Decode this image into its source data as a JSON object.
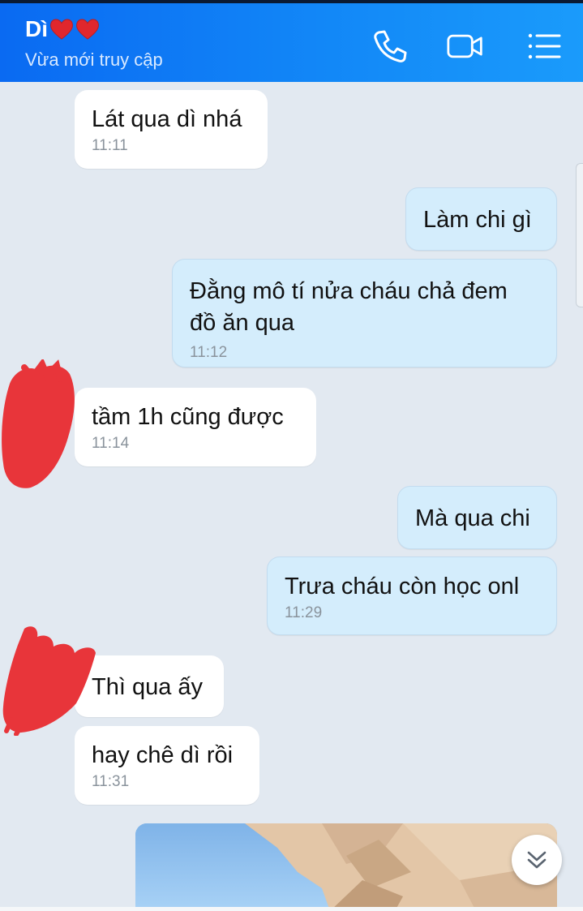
{
  "header": {
    "contact_name": "Dì",
    "status": "Vừa mới truy cập",
    "icons": [
      "phone-icon",
      "video-call-icon",
      "menu-list-icon"
    ]
  },
  "messages": [
    {
      "side": "in",
      "text": "Lát qua dì nhá",
      "time": "11:11"
    },
    {
      "side": "out",
      "text": "Làm chi gì",
      "time": ""
    },
    {
      "side": "out",
      "text": "Đằng mô tí nửa cháu chả đem đồ ăn qua",
      "line1": "Đằng mô tí nửa cháu chả đem",
      "line2": "đồ ăn qua",
      "time": "11:12"
    },
    {
      "side": "in",
      "text": "tầm 1h cũng được",
      "time": "11:14"
    },
    {
      "side": "out",
      "text": "Mà qua chi",
      "time": ""
    },
    {
      "side": "out",
      "text": "Trưa cháu còn học onl",
      "time": "11:29"
    },
    {
      "side": "in",
      "text": "Thì qua ấy",
      "time": ""
    },
    {
      "side": "in",
      "text": "hay chê dì rồi",
      "time": "11:31"
    }
  ],
  "colors": {
    "header_blue": "#0a6af2",
    "incoming_bubble": "#ffffff",
    "outgoing_bubble": "#d4edfc",
    "chat_background": "#e2e9f1",
    "redaction_red": "#e8353a"
  }
}
